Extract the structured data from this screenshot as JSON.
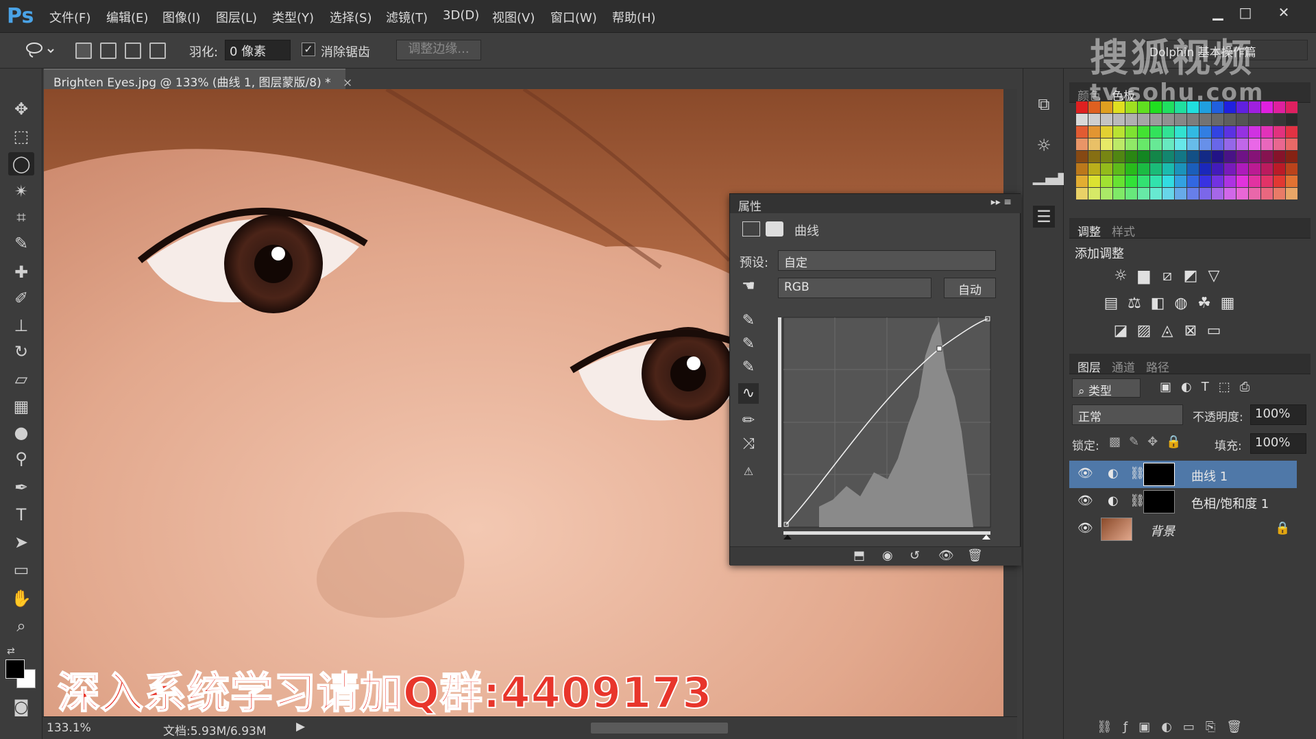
{
  "app": {
    "logo": "Ps"
  },
  "menu": [
    "文件(F)",
    "编辑(E)",
    "图像(I)",
    "图层(L)",
    "类型(Y)",
    "选择(S)",
    "滤镜(T)",
    "3D(D)",
    "视图(V)",
    "窗口(W)",
    "帮助(H)"
  ],
  "window_controls": {
    "minimize": "▁",
    "maximize": "□",
    "close": "✕"
  },
  "options": {
    "feather_label": "羽化:",
    "feather_value": "0 像素",
    "antialias_label": "消除锯齿",
    "antialias_checked": true,
    "refine_edge_label": "调整边缘...",
    "workspace": "Dolphin 基本操作篇"
  },
  "document": {
    "tab_title": "Brighten Eyes.jpg @ 133% (曲线 1, 图层蒙版/8) *",
    "close": "×",
    "zoom": "133.1%",
    "doc_size": "文档:5.93M/6.93M"
  },
  "watermark": "搜狐视频",
  "watermark_url": "tv.sohu.com",
  "subtitle": "深入系统学习请加Q群:4409173",
  "properties": {
    "title": "属性",
    "type_label": "曲线",
    "preset_label": "预设:",
    "preset_value": "自定",
    "channel_value": "RGB",
    "auto_button": "自动"
  },
  "swatches_panel": {
    "tabs": [
      "颜色",
      "色板"
    ]
  },
  "adjustments_panel": {
    "tabs": [
      "调整",
      "样式"
    ],
    "add_label": "添加调整"
  },
  "layers_panel": {
    "tabs": [
      "图层",
      "通道",
      "路径"
    ],
    "filter": "类型",
    "blend_mode": "正常",
    "opacity_label": "不透明度:",
    "opacity_value": "100%",
    "lock_label": "锁定:",
    "fill_label": "填充:",
    "fill_value": "100%",
    "layers": [
      {
        "name": "曲线 1",
        "selected": true
      },
      {
        "name": "色相/饱和度 1",
        "selected": false
      },
      {
        "name": "背景",
        "selected": false
      }
    ]
  },
  "colors": {
    "accent": "#4aa3e6",
    "selection": "#4f78a8",
    "subtitle": "#e8352b"
  }
}
